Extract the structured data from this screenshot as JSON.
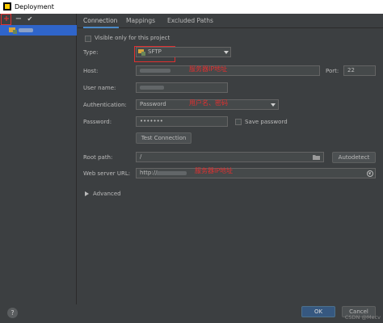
{
  "window": {
    "title": "Deployment"
  },
  "toolbar": {
    "add": "+",
    "remove": "−",
    "check": "✔"
  },
  "tabs": [
    {
      "label": "Connection",
      "active": true
    },
    {
      "label": "Mappings",
      "active": false
    },
    {
      "label": "Excluded Paths",
      "active": false
    }
  ],
  "form": {
    "visible_only_label": "Visible only for this project",
    "type_label": "Type:",
    "type_value": "SFTP",
    "host_label": "Host:",
    "port_label": "Port:",
    "port_value": "22",
    "username_label": "User name:",
    "auth_label": "Authentication:",
    "auth_value": "Password",
    "password_label": "Password:",
    "password_value": "•••••••",
    "save_password_label": "Save password",
    "test_connection_label": "Test Connection",
    "root_path_label": "Root path:",
    "root_path_value": "/",
    "autodetect_label": "Autodetect",
    "web_url_label": "Web server URL:",
    "web_url_value": "http://",
    "advanced_label": "Advanced"
  },
  "annotations": {
    "host_note": "服务器IP地址",
    "auth_note": "用户名、密码",
    "url_note": "服务器IP地址"
  },
  "buttons": {
    "ok": "OK",
    "cancel": "Cancel",
    "help": "?"
  },
  "watermark": "CSDN @Mecv",
  "colors": {
    "accent": "#2f65ca",
    "annotation": "#e03030",
    "background": "#3c3f41"
  }
}
